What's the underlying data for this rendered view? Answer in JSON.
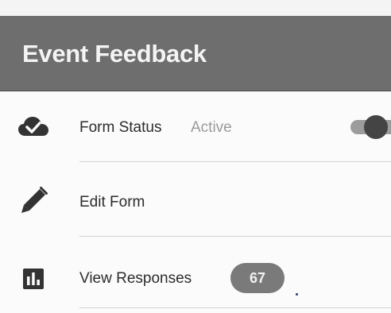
{
  "header": {
    "title": "Event Feedback"
  },
  "form_status": {
    "label": "Form Status",
    "status": "Active",
    "icon": "cloud-check-icon",
    "toggle_on": true
  },
  "edit_form": {
    "label": "Edit Form",
    "icon": "pencil-icon"
  },
  "view_responses": {
    "label": "View Responses",
    "icon": "bar-chart-icon",
    "count": "67"
  },
  "colors": {
    "header_bg": "#6e6e6e",
    "header_text": "#f4f4f4",
    "icon": "#333333",
    "badge_bg": "#7a7a7a"
  }
}
